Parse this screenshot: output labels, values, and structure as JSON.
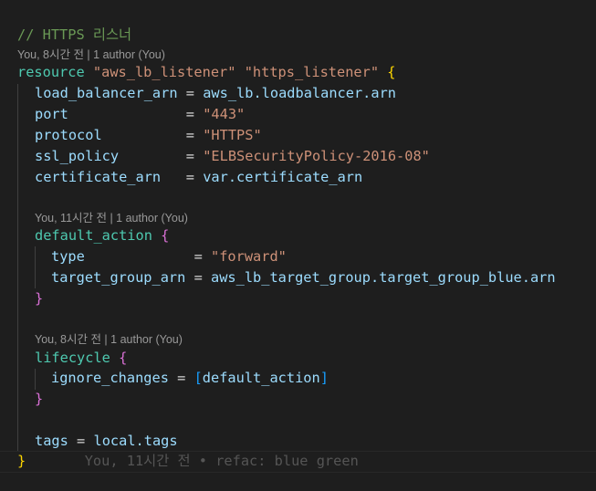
{
  "comment": "// HTTPS 리스너",
  "codelens": [
    "You, 8시간 전 | 1 author (You)",
    "You, 11시간 전 | 1 author (You)",
    "You, 8시간 전 | 1 author (You)"
  ],
  "resource": {
    "kw": "resource",
    "type": "\"aws_lb_listener\"",
    "name": "\"https_listener\""
  },
  "attrs": [
    {
      "key": "load_balancer_arn",
      "pad": " = ",
      "val": "aws_lb.loadbalancer.arn",
      "str": false
    },
    {
      "key": "port",
      "pad": "              = ",
      "val": "\"443\"",
      "str": true
    },
    {
      "key": "protocol",
      "pad": "          = ",
      "val": "\"HTTPS\"",
      "str": true
    },
    {
      "key": "ssl_policy",
      "pad": "        = ",
      "val": "\"ELBSecurityPolicy-2016-08\"",
      "str": true
    },
    {
      "key": "certificate_arn",
      "pad": "   = ",
      "val": "var.certificate_arn",
      "str": false
    }
  ],
  "default_action": {
    "block": "default_action",
    "type_key": "type",
    "type_pad": "             = ",
    "type_val": "\"forward\"",
    "tg_key": "target_group_arn",
    "tg_val": "aws_lb_target_group.target_group_blue.arn"
  },
  "lifecycle": {
    "block": "lifecycle",
    "key": "ignore_changes",
    "val": "default_action"
  },
  "tags": {
    "key": "tags",
    "val": "local.tags"
  },
  "inline_blame": "You, 11시간 전 • refac: blue green"
}
